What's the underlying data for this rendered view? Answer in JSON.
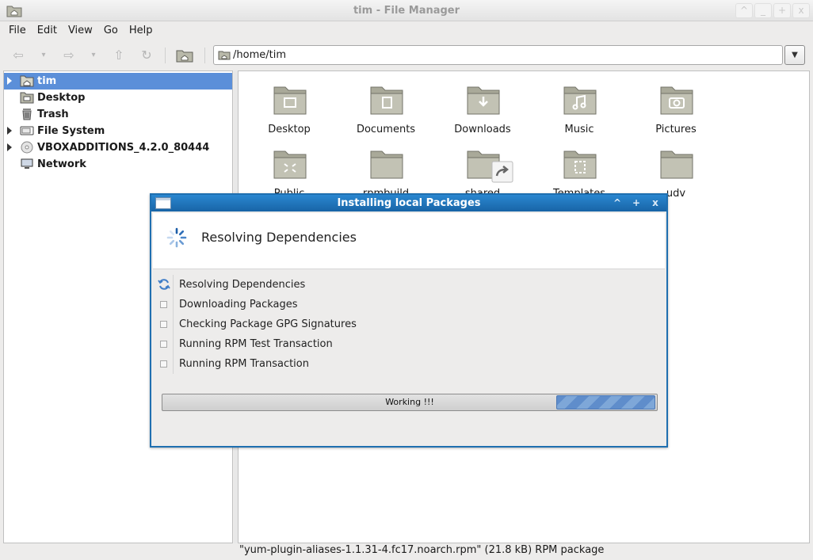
{
  "window": {
    "title": "tim - File Manager",
    "buttons": [
      "^",
      "_",
      "+",
      "x"
    ]
  },
  "menu": [
    "File",
    "Edit",
    "View",
    "Go",
    "Help"
  ],
  "toolbar": {
    "back_icon": "back-arrow-icon",
    "forward_icon": "forward-arrow-icon",
    "up_icon": "up-arrow-icon",
    "reload_icon": "reload-icon",
    "home_icon": "home-folder-icon",
    "address": "/home/tim"
  },
  "sidebar": {
    "items": [
      {
        "label": "tim",
        "icon": "home-folder-icon",
        "expandable": true,
        "selected": true
      },
      {
        "label": "Desktop",
        "icon": "desktop-folder-icon",
        "expandable": false,
        "selected": false
      },
      {
        "label": "Trash",
        "icon": "trash-icon",
        "expandable": false,
        "selected": false
      },
      {
        "label": "File System",
        "icon": "drive-icon",
        "expandable": true,
        "selected": false
      },
      {
        "label": "VBOXADDITIONS_4.2.0_80444",
        "icon": "cdrom-icon",
        "expandable": true,
        "selected": false
      },
      {
        "label": "Network",
        "icon": "network-icon",
        "expandable": false,
        "selected": false
      }
    ]
  },
  "files": [
    {
      "label": "Desktop",
      "icon": "desktop-folder-icon"
    },
    {
      "label": "Documents",
      "icon": "documents-folder-icon"
    },
    {
      "label": "Downloads",
      "icon": "downloads-folder-icon"
    },
    {
      "label": "Music",
      "icon": "music-folder-icon"
    },
    {
      "label": "Pictures",
      "icon": "pictures-folder-icon"
    },
    {
      "label": "Public",
      "icon": "public-folder-icon"
    },
    {
      "label": "rpmbuild",
      "icon": "folder-icon"
    },
    {
      "label": "shared",
      "icon": "symlink-folder-icon"
    },
    {
      "label": "Templates",
      "icon": "templates-folder-icon"
    },
    {
      "label": "udv",
      "icon": "folder-icon"
    }
  ],
  "status": "\"yum-plugin-aliases-1.1.31-4.fc17.noarch.rpm\" (21.8 kB) RPM package",
  "dialog": {
    "title": "Installing local Packages",
    "buttons": [
      "^",
      "+",
      "x"
    ],
    "heading": "Resolving Dependencies",
    "steps": [
      {
        "label": "Resolving Dependencies",
        "state": "active"
      },
      {
        "label": "Downloading Packages",
        "state": "pending"
      },
      {
        "label": "Checking Package GPG Signatures",
        "state": "pending"
      },
      {
        "label": "Running RPM Test Transaction",
        "state": "pending"
      },
      {
        "label": "Running RPM Transaction",
        "state": "pending"
      }
    ],
    "progress_text": "Working !!!",
    "progress_fraction": 0.2
  },
  "colors": {
    "selection": "#5b8fd9",
    "dialog_title": "#1f6fb0",
    "folder": "#a9a999"
  }
}
